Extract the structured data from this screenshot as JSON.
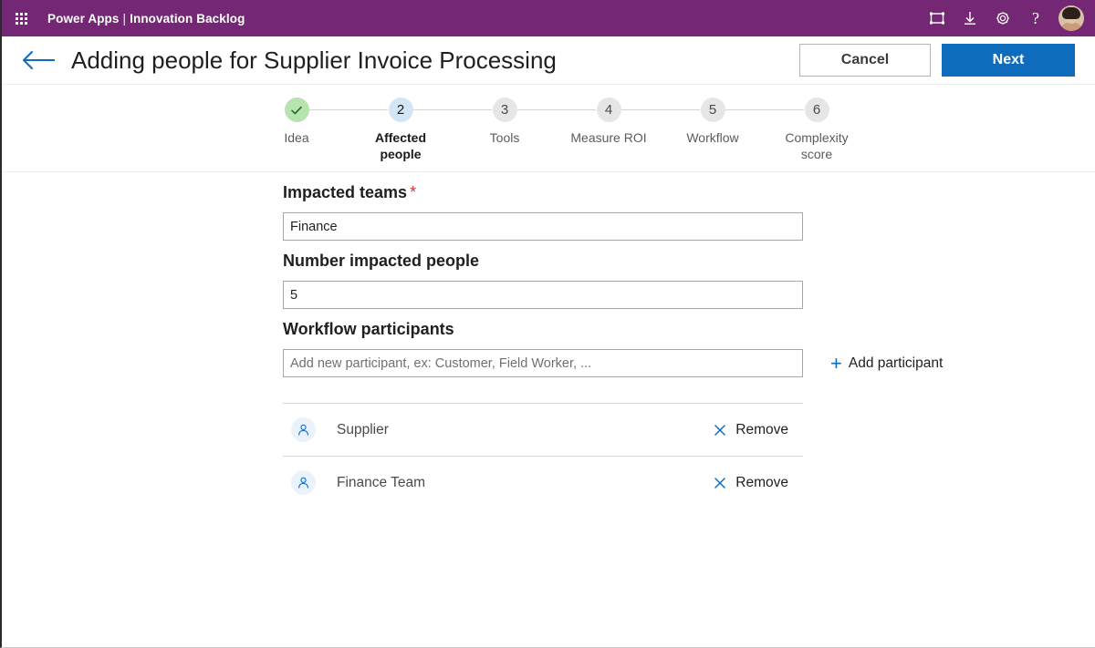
{
  "topbar": {
    "waffle_icon": "app-launcher-waffle-icon",
    "brand": "Power Apps",
    "separator": "|",
    "app_name": "Innovation Backlog",
    "icons": [
      {
        "name": "fit-to-screen-icon",
        "glyph": "frame"
      },
      {
        "name": "download-icon",
        "glyph": "download-arrow"
      },
      {
        "name": "settings-gear-icon",
        "glyph": "gear"
      },
      {
        "name": "help-icon",
        "glyph": "?"
      }
    ],
    "avatar": "user-avatar"
  },
  "titlebar": {
    "back_icon": "back-arrow-icon",
    "title": "Adding people for Supplier Invoice Processing",
    "cancel_label": "Cancel",
    "next_label": "Next"
  },
  "stepper": {
    "steps": [
      {
        "marker": "✓",
        "label": "Idea",
        "state": "done"
      },
      {
        "marker": "2",
        "label": "Affected people",
        "state": "current"
      },
      {
        "marker": "3",
        "label": "Tools",
        "state": "upcoming"
      },
      {
        "marker": "4",
        "label": "Measure ROI",
        "state": "upcoming"
      },
      {
        "marker": "5",
        "label": "Workflow",
        "state": "upcoming"
      },
      {
        "marker": "6",
        "label": "Complexity score",
        "state": "upcoming"
      }
    ]
  },
  "form": {
    "impacted_teams": {
      "label": "Impacted teams",
      "required_marker": "*",
      "value": "Finance",
      "placeholder": ""
    },
    "number_impacted_people": {
      "label": "Number impacted people",
      "value": "5",
      "placeholder": ""
    },
    "workflow_participants": {
      "label": "Workflow participants",
      "value": "",
      "placeholder": "Add new participant, ex: Customer, Field Worker, ...",
      "add_label": "Add participant",
      "add_icon": "plus-icon"
    },
    "participants": [
      {
        "name": "Supplier",
        "remove_label": "Remove"
      },
      {
        "name": "Finance Team",
        "remove_label": "Remove"
      }
    ]
  },
  "colors": {
    "brand_purple": "#742774",
    "accent_blue": "#0f6cbd",
    "required_red": "#d13438",
    "step_done_green": "#b7e3b0",
    "step_active_blue": "#d4e6f5",
    "step_upcoming_gray": "#e6e6e6"
  }
}
